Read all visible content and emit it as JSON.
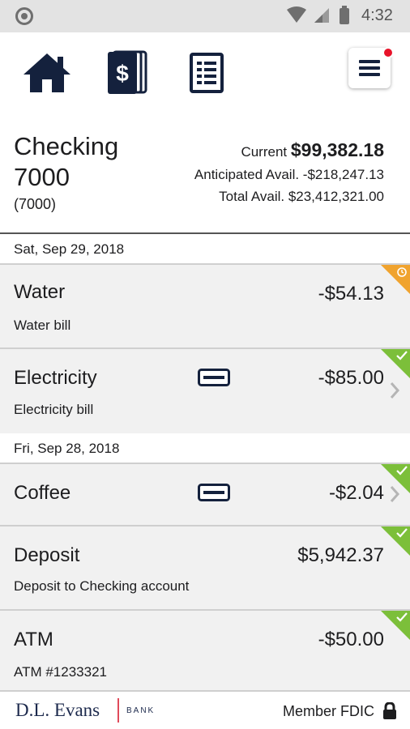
{
  "status_bar": {
    "time": "4:32"
  },
  "nav": {
    "icons": [
      "home-icon",
      "accounts-icon",
      "statements-icon",
      "menu-icon"
    ],
    "menu_has_notification": true
  },
  "account": {
    "name": "Checking 7000",
    "number": "(7000)",
    "current_label": "Current",
    "current_value": "$99,382.18",
    "anticipated": "Anticipated Avail. -$218,247.13",
    "total": "Total Avail. $23,412,321.00"
  },
  "dates": [
    "Sat, Sep 29, 2018",
    "Fri, Sep 28, 2018"
  ],
  "transactions": [
    {
      "title": "Water",
      "subtitle": "Water bill",
      "amount": "-$54.13",
      "status": "pending"
    },
    {
      "title": "Electricity",
      "subtitle": "Electricity bill",
      "amount": "-$85.00",
      "status": "cleared"
    },
    {
      "title": "Coffee",
      "subtitle": "",
      "amount": "-$2.04",
      "status": "cleared"
    },
    {
      "title": "Deposit",
      "subtitle": "Deposit to Checking account",
      "amount": "$5,942.37",
      "status": "cleared"
    },
    {
      "title": "ATM",
      "subtitle": "ATM #1233321",
      "amount": "-$50.00",
      "status": "cleared"
    }
  ],
  "footer": {
    "logo_text": "D.L. Evans",
    "logo_sub": "BANK",
    "member_text": "Member FDIC"
  },
  "colors": {
    "navy": "#1d2a4d",
    "cleared": "#7cbf3a",
    "pending": "#f0a32e",
    "notification": "#e8132a"
  }
}
